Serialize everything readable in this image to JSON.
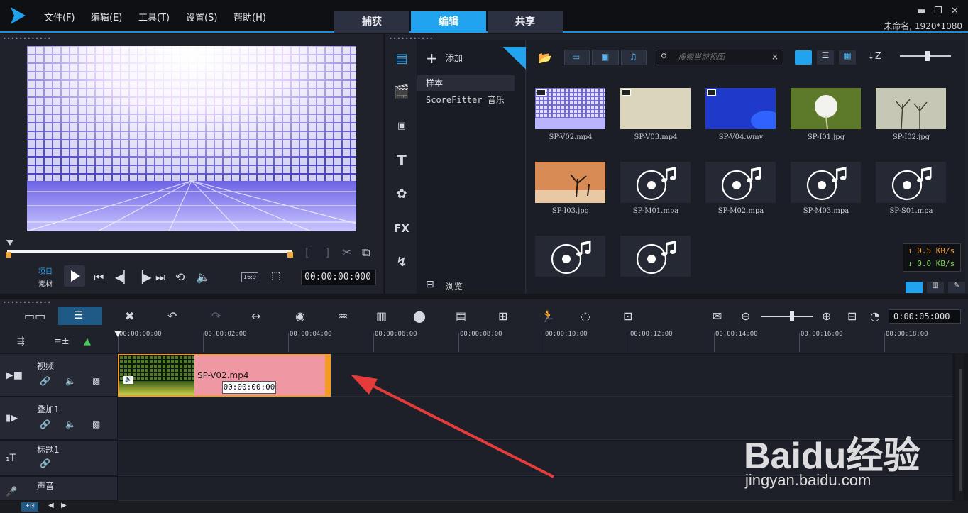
{
  "menu": [
    "文件(F)",
    "编辑(E)",
    "工具(T)",
    "设置(S)",
    "帮助(H)"
  ],
  "tabs": [
    "捕获",
    "编辑",
    "共享"
  ],
  "project_info": "未命名, 1920*1080",
  "player": {
    "mode_project": "项目",
    "mode_clip": "素材",
    "aspect": "16:9",
    "timecode": "00:00:00:000",
    "scrub_position": 0.0
  },
  "library": {
    "add_label": "添加",
    "folders": [
      "样本",
      "ScoreFitter 音乐"
    ],
    "browse_label": "浏览",
    "search_placeholder": "搜索当前视图",
    "clear_icon": "×",
    "items": [
      {
        "name": "SP-V02.mp4",
        "kind": "video"
      },
      {
        "name": "SP-V03.mp4",
        "kind": "video"
      },
      {
        "name": "SP-V04.wmv",
        "kind": "video"
      },
      {
        "name": "SP-I01.jpg",
        "kind": "image"
      },
      {
        "name": "SP-I02.jpg",
        "kind": "image"
      },
      {
        "name": "SP-I03.jpg",
        "kind": "image"
      },
      {
        "name": "SP-M01.mpa",
        "kind": "music"
      },
      {
        "name": "SP-M02.mpa",
        "kind": "music"
      },
      {
        "name": "SP-M03.mpa",
        "kind": "music"
      },
      {
        "name": "SP-S01.mpa",
        "kind": "music"
      },
      {
        "name": "",
        "kind": "music"
      },
      {
        "name": "",
        "kind": "music"
      }
    ],
    "speed_up": "↑ 0.5 KB/s",
    "speed_down": "↓ 0.0 KB/s",
    "slider_value": 0.55
  },
  "timeline": {
    "duration": "0:00:05:000",
    "zoom_value": 0.6,
    "ruler_labels": [
      "00:00:00:00",
      "00:00:02:00",
      "00:00:04:00",
      "00:00:06:00",
      "00:00:08:00",
      "00:00:10:00",
      "00:00:12:00",
      "00:00:14:00",
      "00:00:16:00",
      "00:00:18:00"
    ],
    "tracks": [
      "视频",
      "叠加1",
      "标题1",
      "声音"
    ],
    "clip_name": "SP-V02.mp4",
    "clip_tooltip": "00:00:00:00"
  },
  "watermark": {
    "brand": "Baidu经验",
    "url": "jingyan.baidu.com"
  },
  "colors": {
    "accent": "#22a3ef",
    "clip": "#ef97a3",
    "clip_border": "#f39c21",
    "arrow": "#e53b3b"
  }
}
